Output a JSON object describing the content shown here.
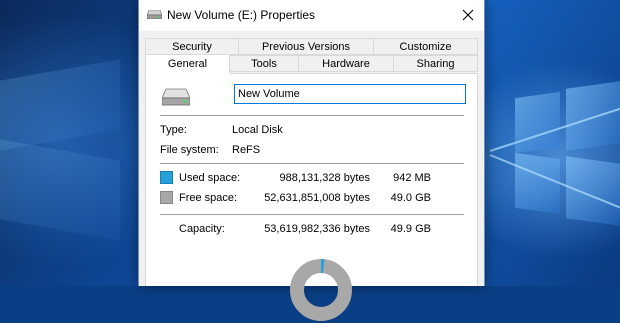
{
  "window": {
    "title": "New Volume (E:) Properties",
    "title_icon": "drive-icon",
    "close_icon": "close-icon"
  },
  "tabs_back": [
    {
      "label": "Security"
    },
    {
      "label": "Previous Versions"
    },
    {
      "label": "Customize"
    }
  ],
  "tabs_front": [
    {
      "label": "General",
      "active": true
    },
    {
      "label": "Tools",
      "active": false
    },
    {
      "label": "Hardware",
      "active": false
    },
    {
      "label": "Sharing",
      "active": false
    }
  ],
  "general": {
    "volume_name": "New Volume",
    "type_label": "Type:",
    "type_value": "Local Disk",
    "fs_label": "File system:",
    "fs_value": "ReFS",
    "used": {
      "label": "Used space:",
      "bytes": "988,131,328 bytes",
      "size": "942 MB",
      "color": "#26a0da"
    },
    "free": {
      "label": "Free space:",
      "bytes": "52,631,851,008 bytes",
      "size": "49.0 GB",
      "color": "#a8a8a8"
    },
    "capacity": {
      "label": "Capacity:",
      "bytes": "53,619,982,336 bytes",
      "size": "49.9 GB"
    },
    "used_fraction": 0.018
  },
  "colors": {
    "accent": "#0078d7",
    "desktop": "#0f4a9c"
  }
}
